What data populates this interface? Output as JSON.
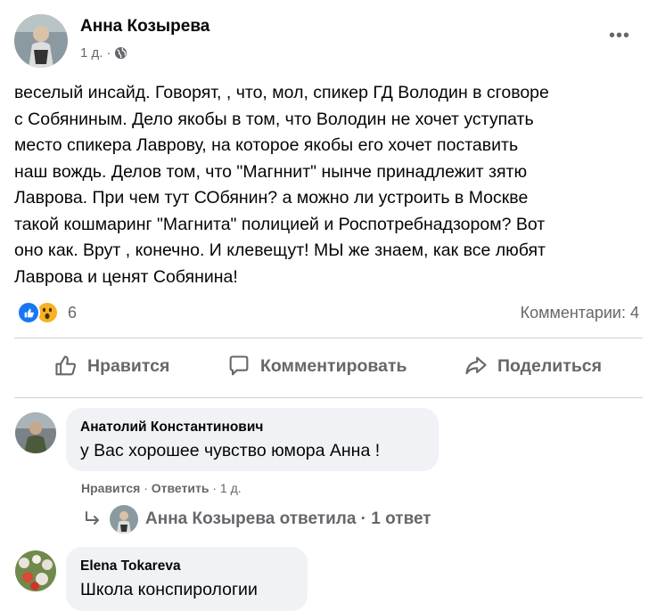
{
  "post": {
    "author": "Анна Козырева",
    "time": "1 д.",
    "separator": "·",
    "more": "•••",
    "text": "веселый инсайд. Говорят, , что, мол, спикер ГД  Володин в сговоре\nс Собяниным.  Дело якобы в том, что Володин не хочет уступать\nместо спикера Лаврову, на которое якобы его хочет поставить\nнаш вождь. Делов том, что  \"Магннит\" нынче принадлежит зятю\nЛаврова. При чем тут СОбянин? а можно ли устроить  в Москве\nтакой кошмаринг \"Магнита\" полицией и Роспотребнадзором?  Вот\nоно как. Врут , конечно. И клевещут!  МЫ же знаем, как все любят\nЛаврова и ценят Собянина!",
    "reaction_count": "6",
    "comment_count": "Комментарии: 4"
  },
  "actions": {
    "like": "Нравится",
    "comment": "Комментировать",
    "share": "Поделиться"
  },
  "comments": [
    {
      "author": "Анатолий Константинович",
      "text": "у Вас хорошее чувство юмора Анна !",
      "like": "Нравится",
      "reply": "Ответить",
      "time": "1 д.",
      "dot": "·"
    },
    {
      "author": "Elena Tokareva",
      "text": "Школа конспирологии"
    }
  ],
  "reply_summary": "Анна Козырева ответила · 1 ответ",
  "colors": {
    "accent": "#1877f2",
    "muted": "#65676b",
    "bubble": "#f0f2f5",
    "wow": "#f7b125"
  },
  "icons": [
    "globe-icon",
    "more-icon",
    "like-reaction-icon",
    "wow-reaction-icon",
    "thumbs-up-icon",
    "comment-icon",
    "share-icon",
    "reply-arrow-icon"
  ]
}
